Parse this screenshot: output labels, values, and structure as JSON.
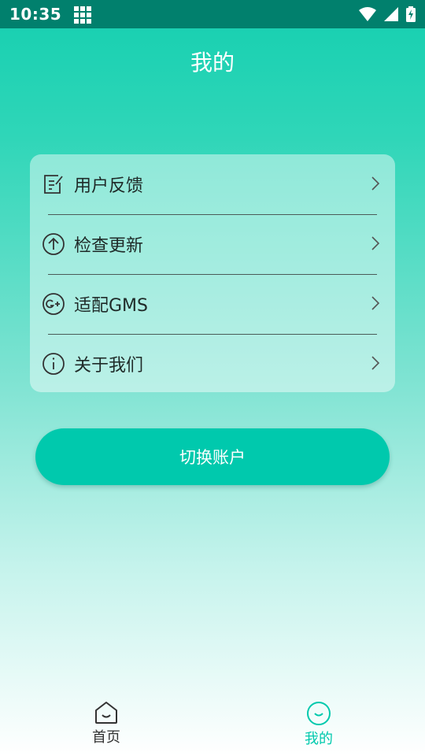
{
  "status_bar": {
    "time": "10:35"
  },
  "header": {
    "title": "我的"
  },
  "menu": {
    "items": [
      {
        "label": "用户反馈",
        "icon": "edit-note-icon"
      },
      {
        "label": "检查更新",
        "icon": "upload-arrow-icon"
      },
      {
        "label": "适配GMS",
        "icon": "google-plus-icon"
      },
      {
        "label": "关于我们",
        "icon": "info-icon"
      }
    ]
  },
  "switch_account": {
    "label": "切换账户"
  },
  "tabbar": {
    "tabs": [
      {
        "label": "首页",
        "icon": "home-icon",
        "active": false
      },
      {
        "label": "我的",
        "icon": "smile-icon",
        "active": true
      }
    ]
  },
  "colors": {
    "status_bar": "#01806d",
    "accent": "#00c9ad",
    "gradient_top": "#15cfb0"
  }
}
